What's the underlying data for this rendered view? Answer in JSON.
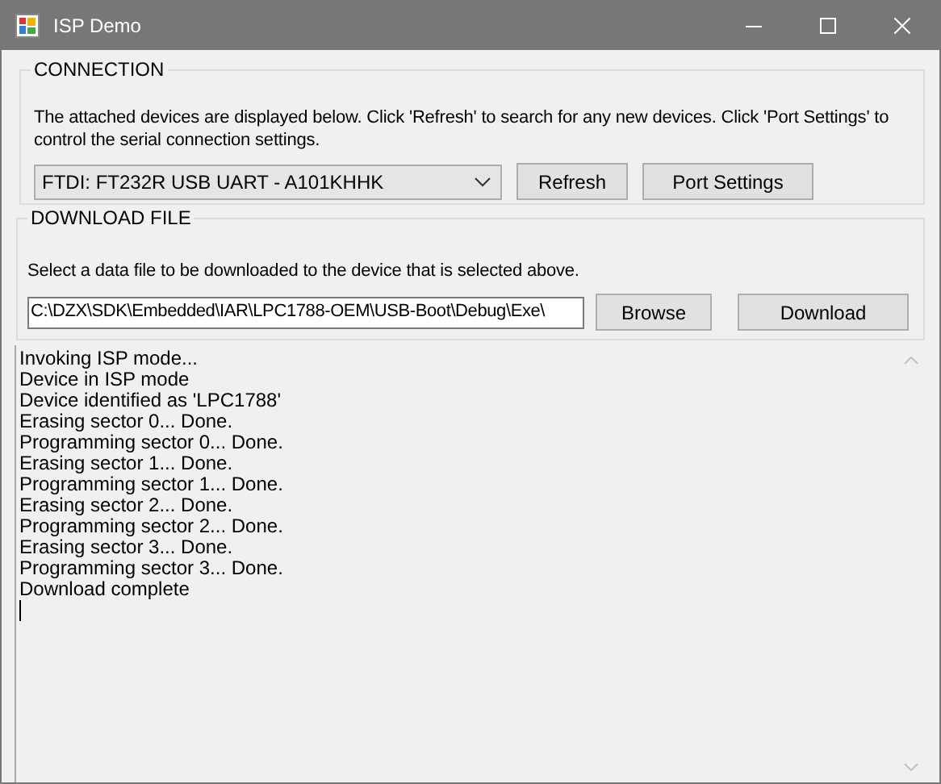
{
  "window": {
    "title": "ISP Demo"
  },
  "connection": {
    "title": "CONNECTION",
    "description": "The attached devices are displayed below. Click 'Refresh' to search for any new devices. Click 'Port Settings' to control the serial connection settings.",
    "device": "FTDI: FT232R USB UART - A101KHHK",
    "buttons": [
      "Refresh",
      "Port Settings"
    ]
  },
  "download_file": {
    "title": "DOWNLOAD FILE",
    "description": "Select a data file to be downloaded to the device that is selected above.",
    "path": "C:\\DZX\\SDK\\Embedded\\IAR\\LPC1788-OEM\\USB-Boot\\Debug\\Exe\\",
    "buttons": [
      "Browse",
      "Download"
    ]
  },
  "log": {
    "lines": [
      "Invoking ISP mode...",
      "Device in ISP mode",
      "Device identified as 'LPC1788'",
      "Erasing sector 0... Done.",
      "Programming sector 0... Done.",
      "Erasing sector 1... Done.",
      "Programming sector 1... Done.",
      "Erasing sector 2... Done.",
      "Programming sector 2... Done.",
      "Erasing sector 3... Done.",
      "Programming sector 3... Done.",
      "Download complete"
    ]
  }
}
